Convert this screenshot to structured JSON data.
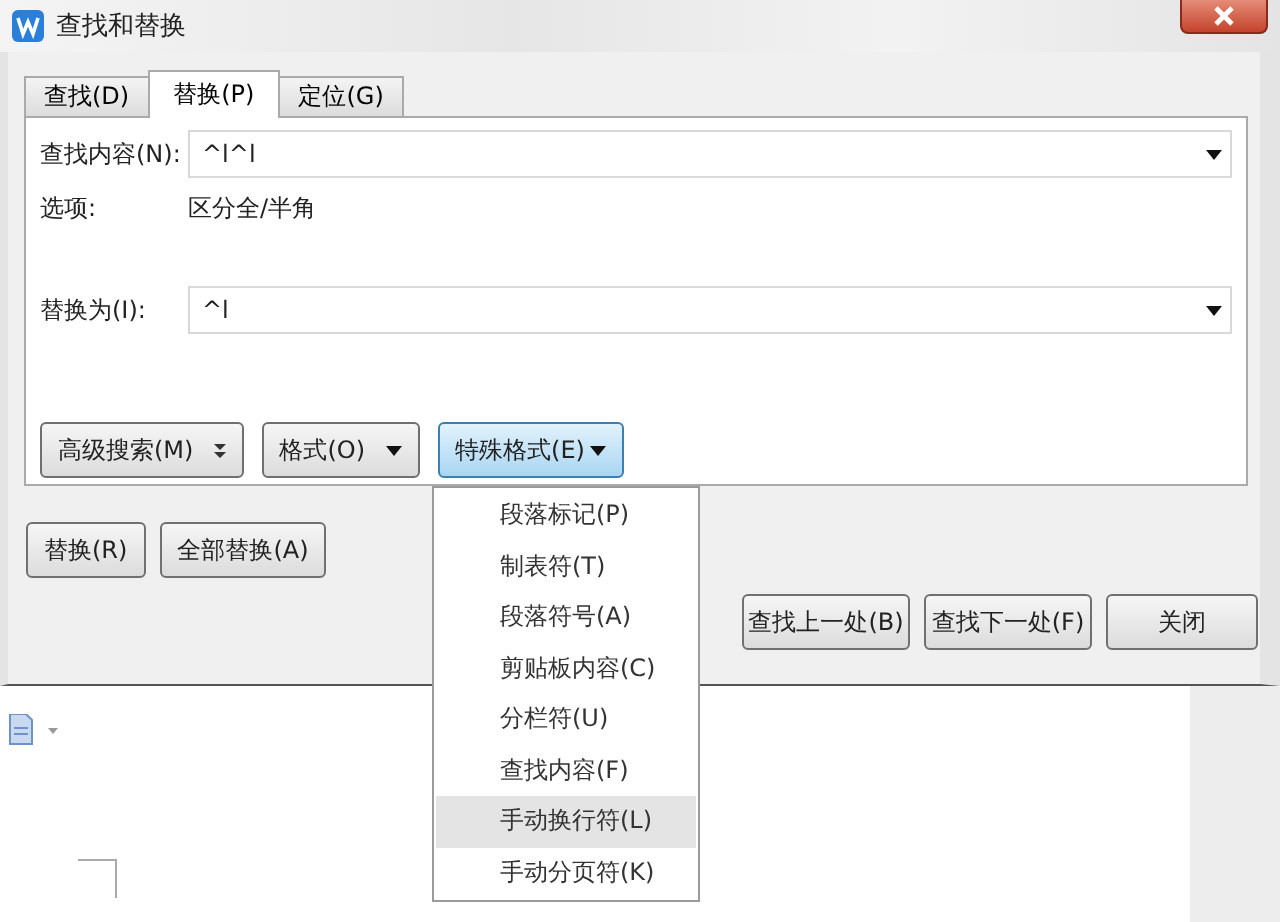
{
  "window": {
    "title": "查找和替换"
  },
  "tabs": [
    {
      "label": "查找(D)",
      "selected": false
    },
    {
      "label": "替换(P)",
      "selected": true
    },
    {
      "label": "定位(G)",
      "selected": false
    }
  ],
  "find": {
    "label": "查找内容(N):",
    "value": "^l^l"
  },
  "options": {
    "label": "选项:",
    "value": "区分全/半角"
  },
  "replace": {
    "label": "替换为(I):",
    "value": "^l"
  },
  "panel_buttons": [
    {
      "label": "高级搜索(M)",
      "kind": "expand",
      "expanded": false
    },
    {
      "label": "格式(O)",
      "kind": "dropdown",
      "expanded": false
    },
    {
      "label": "特殊格式(E)",
      "kind": "dropdown",
      "expanded": true
    }
  ],
  "replace_buttons": [
    "替换(R)",
    "全部替换(A)"
  ],
  "nav_buttons": [
    "查找上一处(B)",
    "查找下一处(F)",
    "关闭"
  ],
  "menu": [
    {
      "label": "段落标记(P)",
      "selected": false
    },
    {
      "label": "制表符(T)",
      "selected": false
    },
    {
      "label": "段落符号(A)",
      "selected": false
    },
    {
      "label": "剪贴板内容(C)",
      "selected": false
    },
    {
      "label": "分栏符(U)",
      "selected": false
    },
    {
      "label": "查找内容(F)",
      "selected": false
    },
    {
      "label": "手动换行符(L)",
      "selected": true
    },
    {
      "label": "手动分页符(K)",
      "selected": false
    }
  ]
}
